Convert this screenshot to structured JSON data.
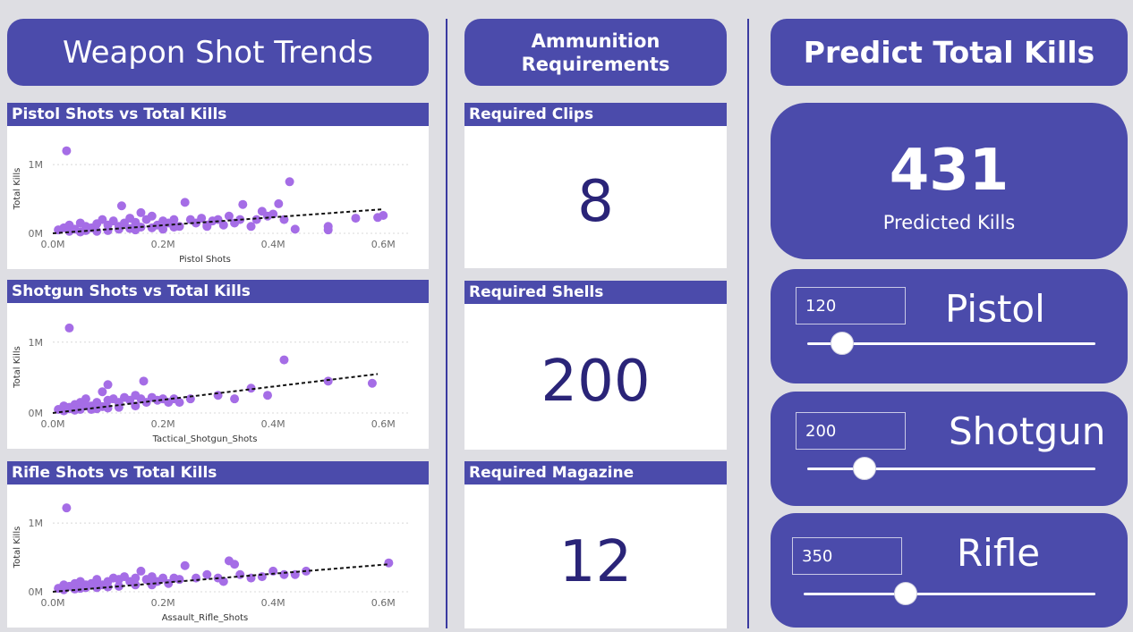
{
  "headers": {
    "left": "Weapon Shot Trends",
    "middle_line1": "Ammunition",
    "middle_line2": "Requirements",
    "right": "Predict Total Kills"
  },
  "colors": {
    "accent": "#4b4bab",
    "point": "#a56de6",
    "number": "#2a2478",
    "background": "#dedee3"
  },
  "chart_data": [
    {
      "type": "scatter",
      "title": "Pistol Shots vs Total Kills",
      "xlabel": "Pistol Shots",
      "ylabel": "Total Kills",
      "xlim": [
        0,
        0.65
      ],
      "ylim": [
        0,
        1.3
      ],
      "x_ticks": [
        "0.0M",
        "0.2M",
        "0.4M",
        "0.6M"
      ],
      "x_tick_values": [
        0,
        0.2,
        0.4,
        0.6
      ],
      "y_ticks": [
        "0M",
        "1M"
      ],
      "y_tick_values": [
        0,
        1
      ],
      "units": "millions",
      "trend_line": {
        "x": [
          0,
          0.6
        ],
        "y": [
          0.0,
          0.35
        ]
      },
      "points": [
        [
          0.025,
          1.2
        ],
        [
          0.01,
          0.05
        ],
        [
          0.02,
          0.08
        ],
        [
          0.03,
          0.12
        ],
        [
          0.04,
          0.06
        ],
        [
          0.05,
          0.15
        ],
        [
          0.06,
          0.1
        ],
        [
          0.07,
          0.08
        ],
        [
          0.08,
          0.14
        ],
        [
          0.09,
          0.2
        ],
        [
          0.1,
          0.12
        ],
        [
          0.11,
          0.18
        ],
        [
          0.12,
          0.1
        ],
        [
          0.125,
          0.4
        ],
        [
          0.13,
          0.15
        ],
        [
          0.14,
          0.22
        ],
        [
          0.15,
          0.16
        ],
        [
          0.16,
          0.3
        ],
        [
          0.17,
          0.2
        ],
        [
          0.18,
          0.25
        ],
        [
          0.19,
          0.12
        ],
        [
          0.2,
          0.18
        ],
        [
          0.21,
          0.15
        ],
        [
          0.22,
          0.2
        ],
        [
          0.23,
          0.1
        ],
        [
          0.24,
          0.45
        ],
        [
          0.25,
          0.2
        ],
        [
          0.26,
          0.15
        ],
        [
          0.27,
          0.22
        ],
        [
          0.28,
          0.1
        ],
        [
          0.29,
          0.18
        ],
        [
          0.3,
          0.2
        ],
        [
          0.31,
          0.12
        ],
        [
          0.32,
          0.25
        ],
        [
          0.33,
          0.15
        ],
        [
          0.34,
          0.2
        ],
        [
          0.345,
          0.42
        ],
        [
          0.36,
          0.1
        ],
        [
          0.37,
          0.2
        ],
        [
          0.38,
          0.32
        ],
        [
          0.39,
          0.25
        ],
        [
          0.4,
          0.28
        ],
        [
          0.41,
          0.43
        ],
        [
          0.42,
          0.2
        ],
        [
          0.43,
          0.75
        ],
        [
          0.44,
          0.06
        ],
        [
          0.5,
          0.1
        ],
        [
          0.5,
          0.05
        ],
        [
          0.55,
          0.22
        ],
        [
          0.59,
          0.23
        ],
        [
          0.6,
          0.26
        ],
        [
          0.05,
          0.02
        ],
        [
          0.1,
          0.04
        ],
        [
          0.15,
          0.05
        ],
        [
          0.2,
          0.06
        ],
        [
          0.08,
          0.03
        ],
        [
          0.12,
          0.06
        ],
        [
          0.18,
          0.08
        ],
        [
          0.22,
          0.09
        ],
        [
          0.28,
          0.12
        ],
        [
          0.03,
          0.03
        ],
        [
          0.06,
          0.04
        ],
        [
          0.14,
          0.07
        ],
        [
          0.16,
          0.09
        ]
      ]
    },
    {
      "type": "scatter",
      "title": "Shotgun Shots vs Total Kills",
      "xlabel": "Tactical_Shotgun_Shots",
      "ylabel": "Total Kills",
      "xlim": [
        0,
        0.65
      ],
      "ylim": [
        0,
        1.3
      ],
      "x_ticks": [
        "0.0M",
        "0.2M",
        "0.4M",
        "0.6M"
      ],
      "x_tick_values": [
        0,
        0.2,
        0.4,
        0.6
      ],
      "y_ticks": [
        "0M",
        "1M"
      ],
      "y_tick_values": [
        0,
        1
      ],
      "units": "millions",
      "trend_line": {
        "x": [
          0,
          0.59
        ],
        "y": [
          0.0,
          0.55
        ]
      },
      "points": [
        [
          0.03,
          1.2
        ],
        [
          0.01,
          0.05
        ],
        [
          0.02,
          0.1
        ],
        [
          0.03,
          0.08
        ],
        [
          0.04,
          0.12
        ],
        [
          0.05,
          0.15
        ],
        [
          0.06,
          0.2
        ],
        [
          0.07,
          0.1
        ],
        [
          0.08,
          0.15
        ],
        [
          0.09,
          0.3
        ],
        [
          0.1,
          0.18
        ],
        [
          0.11,
          0.2
        ],
        [
          0.12,
          0.15
        ],
        [
          0.1,
          0.4
        ],
        [
          0.13,
          0.22
        ],
        [
          0.14,
          0.18
        ],
        [
          0.15,
          0.25
        ],
        [
          0.16,
          0.2
        ],
        [
          0.165,
          0.45
        ],
        [
          0.17,
          0.15
        ],
        [
          0.18,
          0.22
        ],
        [
          0.19,
          0.18
        ],
        [
          0.2,
          0.2
        ],
        [
          0.21,
          0.15
        ],
        [
          0.22,
          0.2
        ],
        [
          0.23,
          0.15
        ],
        [
          0.25,
          0.2
        ],
        [
          0.3,
          0.25
        ],
        [
          0.33,
          0.2
        ],
        [
          0.36,
          0.35
        ],
        [
          0.39,
          0.25
        ],
        [
          0.42,
          0.75
        ],
        [
          0.5,
          0.45
        ],
        [
          0.58,
          0.42
        ],
        [
          0.02,
          0.03
        ],
        [
          0.05,
          0.05
        ],
        [
          0.08,
          0.06
        ],
        [
          0.12,
          0.08
        ],
        [
          0.15,
          0.1
        ],
        [
          0.04,
          0.04
        ],
        [
          0.07,
          0.05
        ],
        [
          0.1,
          0.07
        ],
        [
          0.06,
          0.1
        ],
        [
          0.03,
          0.06
        ],
        [
          0.09,
          0.09
        ]
      ]
    },
    {
      "type": "scatter",
      "title": "Rifle Shots vs Total Kills",
      "xlabel": "Assault_Rifle_Shots",
      "ylabel": "Total Kills",
      "xlim": [
        0,
        0.65
      ],
      "ylim": [
        0,
        1.3
      ],
      "x_ticks": [
        "0.0M",
        "0.2M",
        "0.4M",
        "0.6M"
      ],
      "x_tick_values": [
        0,
        0.2,
        0.4,
        0.6
      ],
      "y_ticks": [
        "0M",
        "1M"
      ],
      "y_tick_values": [
        0,
        1
      ],
      "units": "millions",
      "trend_line": {
        "x": [
          0,
          0.61
        ],
        "y": [
          0.0,
          0.4
        ]
      },
      "points": [
        [
          0.025,
          1.22
        ],
        [
          0.01,
          0.05
        ],
        [
          0.02,
          0.1
        ],
        [
          0.03,
          0.08
        ],
        [
          0.04,
          0.12
        ],
        [
          0.05,
          0.15
        ],
        [
          0.06,
          0.1
        ],
        [
          0.07,
          0.12
        ],
        [
          0.08,
          0.18
        ],
        [
          0.09,
          0.1
        ],
        [
          0.1,
          0.15
        ],
        [
          0.11,
          0.2
        ],
        [
          0.12,
          0.18
        ],
        [
          0.13,
          0.22
        ],
        [
          0.14,
          0.15
        ],
        [
          0.15,
          0.2
        ],
        [
          0.16,
          0.3
        ],
        [
          0.17,
          0.18
        ],
        [
          0.18,
          0.22
        ],
        [
          0.19,
          0.15
        ],
        [
          0.2,
          0.2
        ],
        [
          0.21,
          0.12
        ],
        [
          0.22,
          0.2
        ],
        [
          0.23,
          0.18
        ],
        [
          0.24,
          0.38
        ],
        [
          0.26,
          0.2
        ],
        [
          0.28,
          0.25
        ],
        [
          0.3,
          0.2
        ],
        [
          0.31,
          0.15
        ],
        [
          0.32,
          0.45
        ],
        [
          0.33,
          0.4
        ],
        [
          0.34,
          0.25
        ],
        [
          0.36,
          0.2
        ],
        [
          0.38,
          0.22
        ],
        [
          0.4,
          0.3
        ],
        [
          0.42,
          0.25
        ],
        [
          0.44,
          0.25
        ],
        [
          0.46,
          0.3
        ],
        [
          0.61,
          0.42
        ],
        [
          0.02,
          0.03
        ],
        [
          0.05,
          0.05
        ],
        [
          0.08,
          0.06
        ],
        [
          0.12,
          0.08
        ],
        [
          0.15,
          0.1
        ],
        [
          0.18,
          0.1
        ],
        [
          0.04,
          0.04
        ],
        [
          0.1,
          0.07
        ],
        [
          0.06,
          0.06
        ]
      ]
    }
  ],
  "ammo": [
    {
      "title": "Required Clips",
      "value": "8"
    },
    {
      "title": "Required Shells",
      "value": "200"
    },
    {
      "title": "Required Magazine",
      "value": "12"
    }
  ],
  "prediction": {
    "value": "431",
    "label": "Predicted Kills"
  },
  "sliders": [
    {
      "label": "Pistol",
      "value": "120",
      "fraction": 0.12
    },
    {
      "label": "Shotgun",
      "value": "200",
      "fraction": 0.2
    },
    {
      "label": "Rifle",
      "value": "350",
      "fraction": 0.35
    }
  ]
}
